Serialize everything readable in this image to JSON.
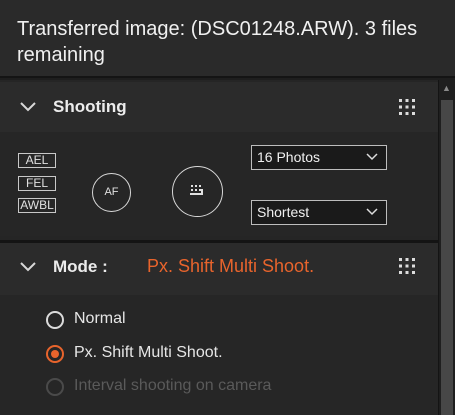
{
  "status": {
    "message": "Transferred image: (DSC01248.ARW). 3 files remaining"
  },
  "shooting": {
    "title": "Shooting",
    "collapse_icon": "chevron-down-icon",
    "grid_icon": "grid-dots-icon",
    "tags": [
      "AEL",
      "FEL",
      "AWBL"
    ],
    "af_label": "AF",
    "release_icon": "shutter-release-icon",
    "photos_select": {
      "value": "16 Photos"
    },
    "interval_select": {
      "value": "Shortest"
    }
  },
  "mode": {
    "title": "Mode :",
    "current": "Px. Shift Multi Shoot.",
    "options": [
      {
        "label": "Normal",
        "selected": false,
        "disabled": false
      },
      {
        "label": "Px. Shift Multi Shoot.",
        "selected": true,
        "disabled": false
      },
      {
        "label": "Interval shooting on camera",
        "selected": false,
        "disabled": true
      }
    ]
  },
  "colors": {
    "accent": "#e8642c",
    "background": "#1e1e1e",
    "panel": "#2b2b2b"
  }
}
